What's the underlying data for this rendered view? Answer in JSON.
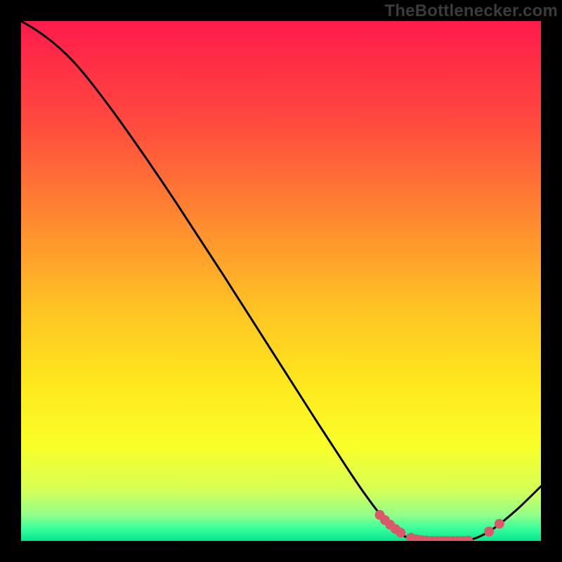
{
  "watermark": "TheBottlenecker.com",
  "chart_data": {
    "type": "line",
    "title": "",
    "xlabel": "",
    "ylabel": "",
    "xlim": [
      0,
      100
    ],
    "ylim": [
      0,
      100
    ],
    "x": [
      0,
      3,
      6,
      9,
      12,
      15,
      18,
      21,
      24,
      27,
      30,
      33,
      36,
      39,
      42,
      45,
      48,
      51,
      54,
      57,
      60,
      63,
      66,
      69,
      72,
      75,
      78,
      81,
      84,
      87,
      90,
      93,
      96,
      100
    ],
    "y": [
      100,
      98.2,
      96,
      93.3,
      90,
      86.2,
      82.2,
      78,
      73.7,
      69.3,
      64.8,
      60.2,
      55.6,
      51,
      46.3,
      41.6,
      36.9,
      32.2,
      27.5,
      22.8,
      18.2,
      13.6,
      9.2,
      5.2,
      2,
      0.4,
      0.0,
      0.0,
      0.0,
      0.4,
      1.8,
      4.0,
      6.6,
      10.5
    ],
    "markers": {
      "x": [
        69,
        70,
        71,
        72,
        73,
        75,
        76,
        77,
        78,
        79,
        80,
        81,
        82,
        83,
        84,
        85,
        86,
        90,
        92
      ],
      "y": [
        5.0,
        4.0,
        3.1,
        2.3,
        1.6,
        0.6,
        0.3,
        0.15,
        0.05,
        0.0,
        0.0,
        0.0,
        0.0,
        0.0,
        0.0,
        0.0,
        0.05,
        1.8,
        3.3
      ]
    },
    "gradient_stops": [
      {
        "offset": 0.0,
        "color": "#ff1b4b"
      },
      {
        "offset": 0.2,
        "color": "#ff4b3e"
      },
      {
        "offset": 0.4,
        "color": "#ff8f2f"
      },
      {
        "offset": 0.55,
        "color": "#ffc224"
      },
      {
        "offset": 0.7,
        "color": "#ffe81e"
      },
      {
        "offset": 0.82,
        "color": "#f9ff2a"
      },
      {
        "offset": 0.9,
        "color": "#d7ff55"
      },
      {
        "offset": 0.95,
        "color": "#93ff8a"
      },
      {
        "offset": 0.975,
        "color": "#3bff9c"
      },
      {
        "offset": 1.0,
        "color": "#05e58e"
      }
    ],
    "curve_color": "#000000",
    "marker_color": "#d9596a"
  }
}
